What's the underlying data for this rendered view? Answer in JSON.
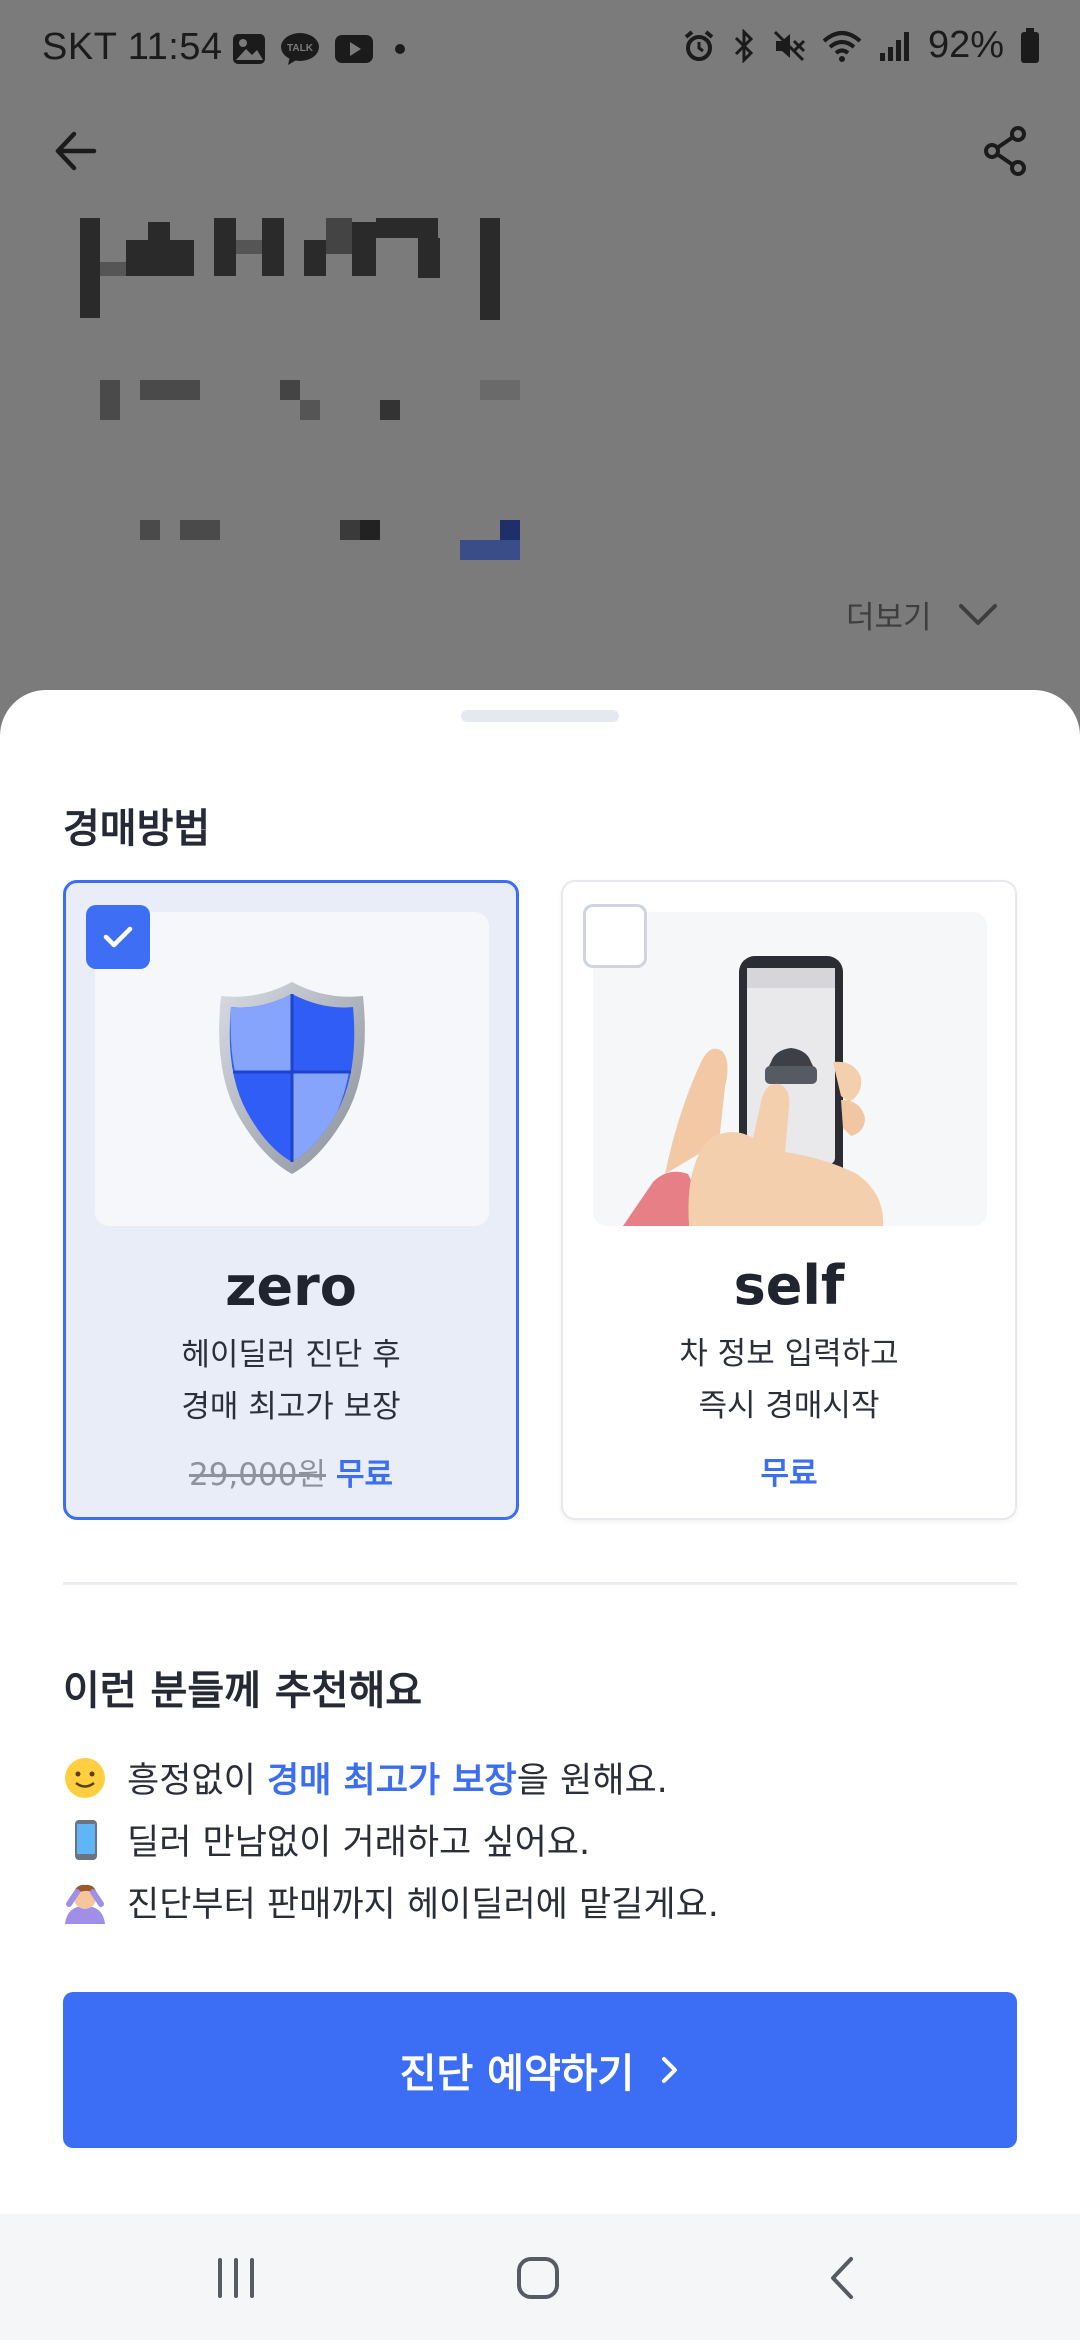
{
  "status_bar": {
    "carrier_time": "SKT 11:54",
    "battery": "92%",
    "left_icons": [
      "gallery-icon",
      "kakaotalk-icon",
      "youtube-icon",
      "dot-icon"
    ],
    "right_icons": [
      "alarm-icon",
      "bluetooth-icon",
      "mute-icon",
      "wifi-icon",
      "signal-icon",
      "battery-icon"
    ]
  },
  "header": {
    "back_icon": "arrow-left-icon",
    "share_icon": "share-icon",
    "more_label": "더보기"
  },
  "sheet": {
    "section_title": "경매방법",
    "options": [
      {
        "title": "zero",
        "desc_line1": "헤이딜러 진단 후",
        "desc_line2": "경매 최고가 보장",
        "price_original": "29,000원",
        "price_label": "무료",
        "selected": true,
        "image": "shield-icon"
      },
      {
        "title": "self",
        "desc_line1": "차 정보 입력하고",
        "desc_line2": "즉시 경매시작",
        "price_label": "무료",
        "selected": false,
        "image": "phone-hand-icon"
      }
    ],
    "recommend_title": "이런 분들께 추천해요",
    "recommendations": [
      {
        "icon": "smiley-emoji",
        "before": "흥정없이 ",
        "highlight": "경매 최고가 보장",
        "after": "을 원해요."
      },
      {
        "icon": "phone-emoji",
        "text": "딜러 만남없이 거래하고 싶어요."
      },
      {
        "icon": "person-emoji",
        "text": "진단부터 판매까지 헤이딜러에 맡길게요."
      }
    ],
    "cta_label": "진단 예약하기"
  },
  "colors": {
    "accent": "#3c6ef5",
    "highlight_text": "#3b6ef0",
    "selected_card_bg": "#e9edf8"
  },
  "nav_bar": [
    "recent-apps-icon",
    "home-icon",
    "back-icon"
  ]
}
